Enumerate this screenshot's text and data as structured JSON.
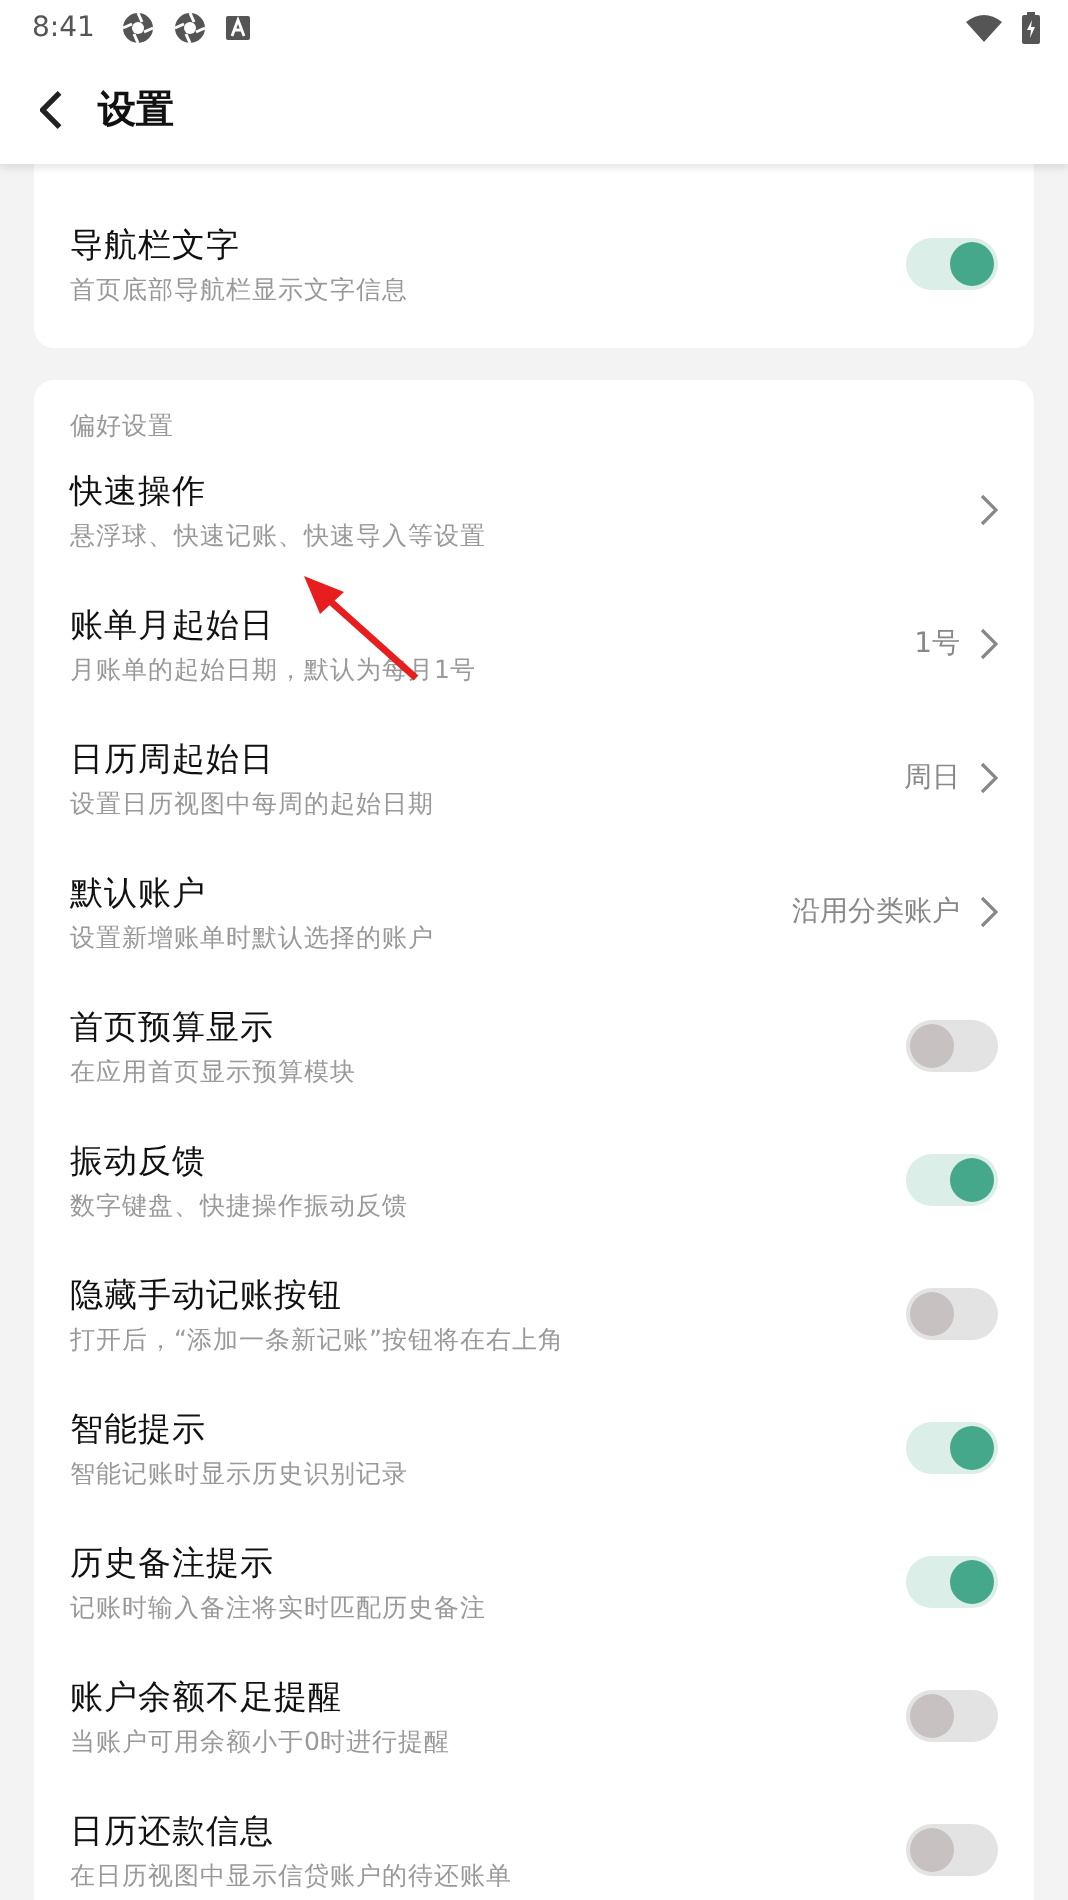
{
  "status_bar": {
    "time": "8:41"
  },
  "header": {
    "title": "设置"
  },
  "cards": [
    {
      "items": [
        {
          "kind": "toggle",
          "title": "导航栏文字",
          "subtitle": "首页底部导航栏显示文字信息",
          "on": true
        }
      ]
    },
    {
      "section": "偏好设置",
      "items": [
        {
          "kind": "link",
          "title": "快速操作",
          "subtitle": "悬浮球、快速记账、快速导入等设置"
        },
        {
          "kind": "link",
          "title": "账单月起始日",
          "subtitle": "月账单的起始日期，默认为每月1号",
          "value": "1号"
        },
        {
          "kind": "link",
          "title": "日历周起始日",
          "subtitle": "设置日历视图中每周的起始日期",
          "value": "周日"
        },
        {
          "kind": "link",
          "title": "默认账户",
          "subtitle": "设置新增账单时默认选择的账户",
          "value": "沿用分类账户"
        },
        {
          "kind": "toggle",
          "title": "首页预算显示",
          "subtitle": "在应用首页显示预算模块",
          "on": false
        },
        {
          "kind": "toggle",
          "title": "振动反馈",
          "subtitle": "数字键盘、快捷操作振动反馈",
          "on": true
        },
        {
          "kind": "toggle",
          "title": "隐藏手动记账按钮",
          "subtitle": "打开后，“添加一条新记账”按钮将在右上角",
          "on": false
        },
        {
          "kind": "toggle",
          "title": "智能提示",
          "subtitle": "智能记账时显示历史识别记录",
          "on": true
        },
        {
          "kind": "toggle",
          "title": "历史备注提示",
          "subtitle": "记账时输入备注将实时匹配历史备注",
          "on": true
        },
        {
          "kind": "toggle",
          "title": "账户余额不足提醒",
          "subtitle": "当账户可用余额小于0时进行提醒",
          "on": false
        },
        {
          "kind": "toggle",
          "title": "日历还款信息",
          "subtitle": "在日历视图中显示信贷账户的待还账单",
          "on": false
        }
      ]
    }
  ]
}
